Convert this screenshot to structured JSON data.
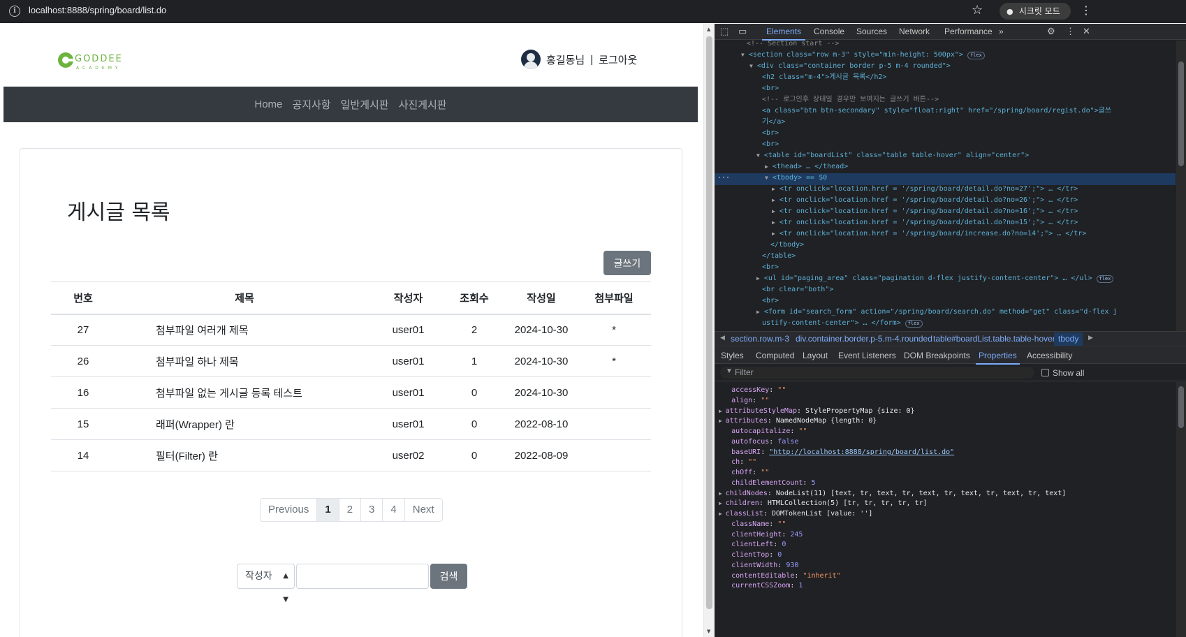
{
  "browser": {
    "url": "localhost:8888/spring/board/list.do",
    "incognito_label": "시크릿 모드",
    "icons": [
      "info-icon",
      "star-icon",
      "incognito-icon",
      "kebab-menu-icon"
    ]
  },
  "site": {
    "logo_text": "GODDEE",
    "logo_sub": "ACADEMY",
    "user_greeting": "홍길동님",
    "separator": "|",
    "logout": "로그아웃",
    "nav": [
      "Home",
      "공지사항",
      "일반게시판",
      "사진게시판"
    ]
  },
  "board": {
    "title": "게시글 목록",
    "write_button": "글쓰기",
    "columns": [
      "번호",
      "제목",
      "작성자",
      "조회수",
      "작성일",
      "첨부파일"
    ],
    "rows": [
      {
        "no": "27",
        "title": "첨부파일 여러개 제목",
        "writer": "user01",
        "views": "2",
        "date": "2024-10-30",
        "attach": "*"
      },
      {
        "no": "26",
        "title": "첨부파일 하나 제목",
        "writer": "user01",
        "views": "1",
        "date": "2024-10-30",
        "attach": "*"
      },
      {
        "no": "16",
        "title": "첨부파일 없는 게시글 등록 테스트",
        "writer": "user01",
        "views": "0",
        "date": "2024-10-30",
        "attach": ""
      },
      {
        "no": "15",
        "title": "래퍼(Wrapper) 란",
        "writer": "user01",
        "views": "0",
        "date": "2022-08-10",
        "attach": ""
      },
      {
        "no": "14",
        "title": "필터(Filter) 란",
        "writer": "user02",
        "views": "0",
        "date": "2022-08-09",
        "attach": ""
      }
    ],
    "pagination": {
      "previous": "Previous",
      "pages": [
        "1",
        "2",
        "3",
        "4"
      ],
      "current": "1",
      "next": "Next"
    },
    "search": {
      "select_value": "작성자",
      "input_value": "",
      "button": "검색"
    }
  },
  "devtools": {
    "tabs": [
      "Elements",
      "Console",
      "Sources",
      "Network",
      "Performance",
      "»"
    ],
    "active_tab": "Elements",
    "dom_lines": [
      "<!-- Section start -->",
      "<section class=\"row m-3\" style=\"min-height: 500px\">",
      "<div class=\"container border p-5 m-4 rounded\">",
      "<h2 class=\"m-4\">게시글 목록</h2>",
      "<br>",
      "<!-- 로그인후 상태일 경우만 보여지는 글쓰기 버튼-->",
      "<a class=\"btn btn-secondary\" style=\"float:right\" href=\"/spring/board/regist.do\">글쓰",
      "기</a>",
      "<br>",
      "<br>",
      "<table id=\"boardList\" class=\"table table-hover\" align=\"center\">",
      "<thead> … </thead>",
      "<tbody> == $0",
      "<tr onclick=\"location.href = '/spring/board/detail.do?no=27';\"> … </tr>",
      "<tr onclick=\"location.href = '/spring/board/detail.do?no=26';\"> … </tr>",
      "<tr onclick=\"location.href = '/spring/board/detail.do?no=16';\"> … </tr>",
      "<tr onclick=\"location.href = '/spring/board/detail.do?no=15';\"> … </tr>",
      "<tr onclick=\"location.href = '/spring/board/increase.do?no=14';\"> … </tr>",
      "</tbody>",
      "</table>",
      "<br>",
      "<ul id=\"paging_area\" class=\"pagination d-flex justify-content-center\"> … </ul>",
      "<br clear=\"both\">",
      "<br>",
      "<form id=\"search_form\" action=\"/spring/board/search.do\" method=\"get\" class=\"d-flex j",
      "ustify-content-center\"> … </form>"
    ],
    "breadcrumbs": [
      "section.row.m-3",
      "div.container.border.p-5.m-4.rounded",
      "table#boardList.table.table-hover",
      "tbody"
    ],
    "sub_tabs": [
      "Styles",
      "Computed",
      "Layout",
      "Event Listeners",
      "DOM Breakpoints",
      "Properties",
      "Accessibility"
    ],
    "active_sub_tab": "Properties",
    "filter_placeholder": "Filter",
    "show_all": "Show all",
    "properties": [
      {
        "key": "accessKey",
        "value": "\"\"",
        "kind": "str",
        "expandable": false
      },
      {
        "key": "align",
        "value": "\"\"",
        "kind": "str",
        "expandable": false
      },
      {
        "key": "attributeStyleMap",
        "value": "StylePropertyMap {size: 0}",
        "kind": "obj",
        "expandable": true
      },
      {
        "key": "attributes",
        "value": "NamedNodeMap {length: 0}",
        "kind": "obj",
        "expandable": true
      },
      {
        "key": "autocapitalize",
        "value": "\"\"",
        "kind": "str",
        "expandable": false
      },
      {
        "key": "autofocus",
        "value": "false",
        "kind": "kw",
        "expandable": false
      },
      {
        "key": "baseURI",
        "value": "\"http://localhost:8888/spring/board/list.do\"",
        "kind": "link",
        "expandable": false
      },
      {
        "key": "ch",
        "value": "\"\"",
        "kind": "str",
        "expandable": false
      },
      {
        "key": "chOff",
        "value": "\"\"",
        "kind": "str",
        "expandable": false
      },
      {
        "key": "childElementCount",
        "value": "5",
        "kind": "num",
        "expandable": false
      },
      {
        "key": "childNodes",
        "value": "NodeList(11) [text, tr, text, tr, text, tr, text, tr, text, tr, text]",
        "kind": "obj",
        "expandable": true
      },
      {
        "key": "children",
        "value": "HTMLCollection(5) [tr, tr, tr, tr, tr]",
        "kind": "obj",
        "expandable": true
      },
      {
        "key": "classList",
        "value": "DOMTokenList [value: '']",
        "kind": "obj",
        "expandable": true
      },
      {
        "key": "className",
        "value": "\"\"",
        "kind": "str",
        "expandable": false
      },
      {
        "key": "clientHeight",
        "value": "245",
        "kind": "num",
        "expandable": false
      },
      {
        "key": "clientLeft",
        "value": "0",
        "kind": "num",
        "expandable": false
      },
      {
        "key": "clientTop",
        "value": "0",
        "kind": "num",
        "expandable": false
      },
      {
        "key": "clientWidth",
        "value": "930",
        "kind": "num",
        "expandable": false
      },
      {
        "key": "contentEditable",
        "value": "\"inherit\"",
        "kind": "str",
        "expandable": false
      },
      {
        "key": "currentCSSZoom",
        "value": "1",
        "kind": "num",
        "expandable": false
      }
    ]
  }
}
